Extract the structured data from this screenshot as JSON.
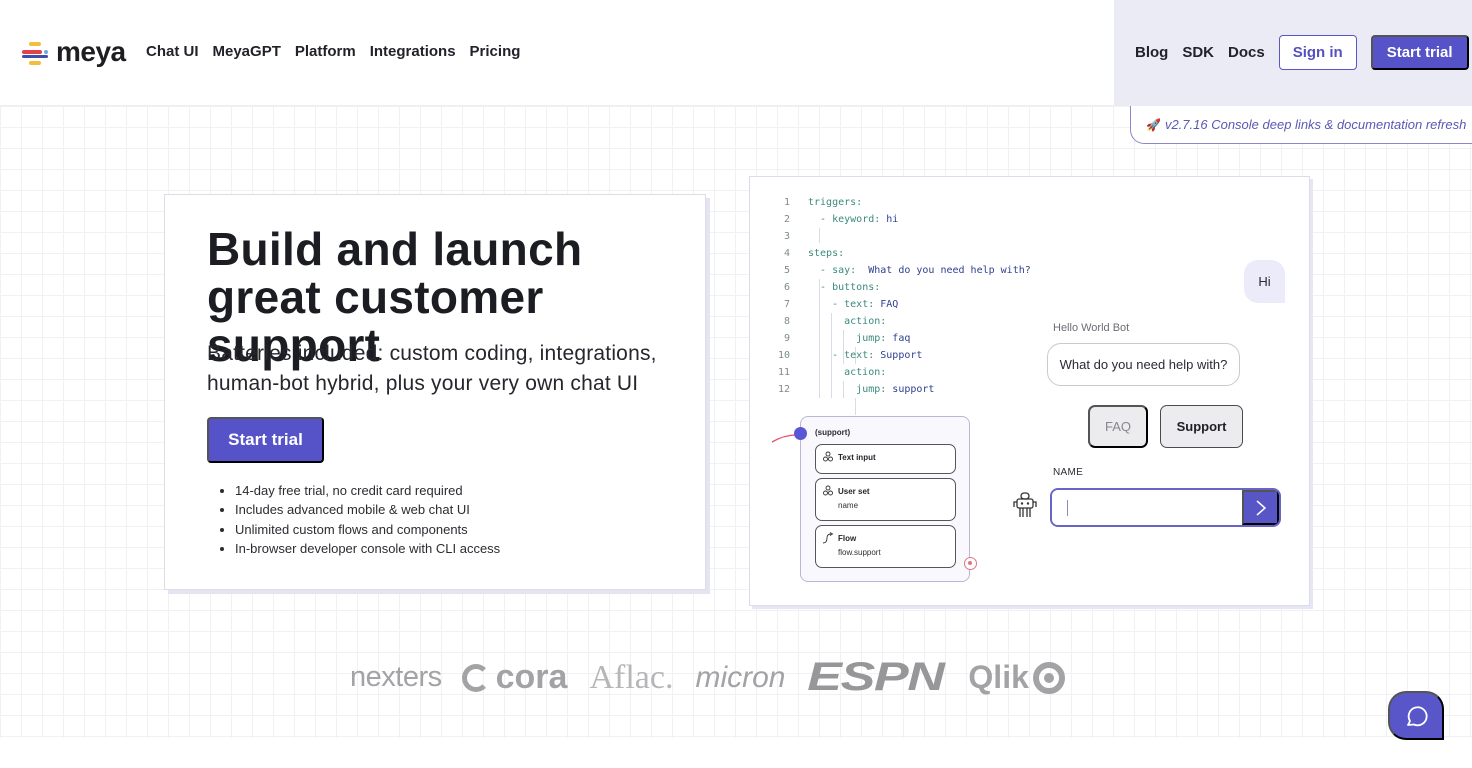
{
  "header": {
    "brand": "meya",
    "nav_left": [
      "Chat UI",
      "MeyaGPT",
      "Platform",
      "Integrations",
      "Pricing"
    ],
    "nav_right": [
      "Blog",
      "SDK",
      "Docs"
    ],
    "sign_in_label": "Sign in",
    "start_trial_label": "Start trial",
    "brand_colors": {
      "primary": "#5653c8",
      "header_right_bg": "#ebebf6"
    }
  },
  "release_banner": {
    "icon": "rocket-icon",
    "text": "v2.7.16 Console deep links & documentation refresh"
  },
  "hero": {
    "title": "Build and launch great customer support",
    "subtitle": "Batteries included: custom coding, integrations, human-bot hybrid, plus your very own chat UI",
    "cta_label": "Start trial",
    "features": [
      "14-day free trial, no credit card required",
      "Includes advanced mobile & web chat UI",
      "Unlimited custom flows and components",
      "In-browser developer console with CLI access"
    ]
  },
  "demo": {
    "code_lines": [
      {
        "n": "1",
        "indent": "",
        "key": "triggers:",
        "val": ""
      },
      {
        "n": "2",
        "indent": "  ",
        "key": "- keyword:",
        "val": " hi"
      },
      {
        "n": "3",
        "indent": "",
        "key": "",
        "val": ""
      },
      {
        "n": "4",
        "indent": "",
        "key": "steps:",
        "val": ""
      },
      {
        "n": "5",
        "indent": "  ",
        "key": "- say:",
        "val": "  What do you need help with?"
      },
      {
        "n": "6",
        "indent": "  ",
        "key": "- buttons:",
        "val": ""
      },
      {
        "n": "7",
        "indent": "    ",
        "key": "- text:",
        "val": " FAQ"
      },
      {
        "n": "8",
        "indent": "      ",
        "key": "action:",
        "val": ""
      },
      {
        "n": "9",
        "indent": "        ",
        "key": "jump:",
        "val": " faq"
      },
      {
        "n": "10",
        "indent": "    ",
        "key": "- text:",
        "val": " Support"
      },
      {
        "n": "11",
        "indent": "      ",
        "key": "action:",
        "val": ""
      },
      {
        "n": "12",
        "indent": "        ",
        "key": "jump:",
        "val": " support"
      }
    ],
    "chat": {
      "user_message": "Hi",
      "bot_name": "Hello World Bot",
      "bot_message": "What do you need help with?",
      "quick_replies": [
        "FAQ",
        "Support"
      ],
      "input_label": "NAME",
      "input_value": ""
    },
    "flow": {
      "title": "(support)",
      "nodes": [
        {
          "title": "Text input",
          "subtitle": "",
          "icon": "component-icon"
        },
        {
          "title": "User set",
          "subtitle": "name",
          "icon": "component-icon"
        },
        {
          "title": "Flow",
          "subtitle": "flow.support",
          "icon": "flow-icon"
        }
      ]
    }
  },
  "customer_logos": [
    "nexters",
    "cora",
    "Aflac.",
    "micron",
    "ESPN",
    "Qlik"
  ]
}
